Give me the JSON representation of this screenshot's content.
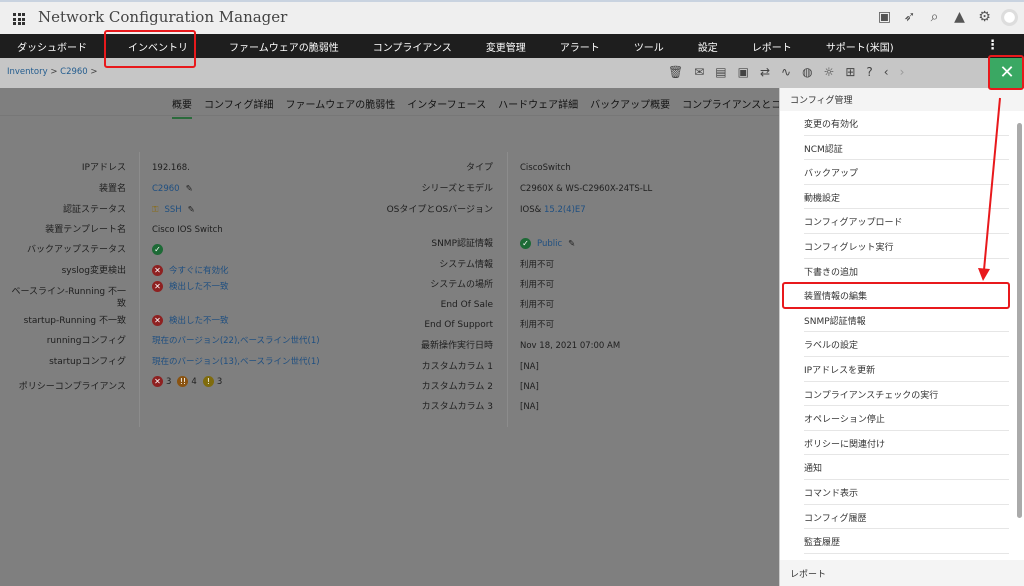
{
  "header": {
    "title": "Network Configuration Manager",
    "icons": [
      "presentation-icon",
      "rocket-icon",
      "search-icon",
      "bell-icon",
      "gear-icon",
      "user-avatar-icon"
    ]
  },
  "nav": [
    "ダッシュボード",
    "インベントリ",
    "ファームウェアの脆弱性",
    "コンプライアンス",
    "変更管理",
    "アラート",
    "ツール",
    "設定",
    "レポート",
    "サポート(米国)"
  ],
  "breadcrumb": {
    "root": "Inventory",
    "device": "C2960",
    "sep": ">"
  },
  "tabs": [
    "概要",
    "コンフィグ詳細",
    "ファームウェアの脆弱性",
    "インターフェース",
    "ハードウェア詳細",
    "バックアップ概要",
    "コンプライアンスとコン"
  ],
  "left_details": [
    {
      "label": "IPアドレス",
      "value": "192.168."
    },
    {
      "label": "装置名",
      "value": "C2960"
    },
    {
      "label": "認証ステータス",
      "value": "SSH"
    },
    {
      "label": "装置テンプレート名",
      "value": "Cisco IOS Switch"
    },
    {
      "label": "バックアップステータス",
      "value": ""
    },
    {
      "label": "syslog変更検出",
      "value": "今すぐに有効化"
    },
    {
      "label": "ベースライン-Running 不一致",
      "value": "検出した不一致"
    },
    {
      "label": "startup-Running 不一致",
      "value": "検出した不一致"
    },
    {
      "label": "runningコンフィグ",
      "value": "現在のバージョン(22),ベースライン世代(1)"
    },
    {
      "label": "startupコンフィグ",
      "value": "現在のバージョン(13),ベースライン世代(1)"
    },
    {
      "label": "ポリシーコンプライアンス",
      "value": "",
      "counts": [
        "3",
        "4",
        "3"
      ]
    }
  ],
  "right_details": [
    {
      "label": "タイプ",
      "value": "CiscoSwitch"
    },
    {
      "label": "シリーズとモデル",
      "value": "C2960X & WS-C2960X-24TS-LL"
    },
    {
      "label": "OSタイプとOSバージョン",
      "value": "IOS&",
      "link": "15.2(4)E7"
    },
    {
      "label": "SNMP認証情報",
      "value": "Public"
    },
    {
      "label": "システム情報",
      "value": "利用不可"
    },
    {
      "label": "システムの場所",
      "value": "利用不可"
    },
    {
      "label": "End Of Sale",
      "value": "利用不可"
    },
    {
      "label": "End Of Support",
      "value": "利用不可"
    },
    {
      "label": "最新操作実行日時",
      "value": "Nov 18, 2021 07:00 AM"
    },
    {
      "label": "カスタムカラム 1",
      "value": "[NA]"
    },
    {
      "label": "カスタムカラム 2",
      "value": "[NA]"
    },
    {
      "label": "カスタムカラム 3",
      "value": "[NA]"
    }
  ],
  "panel": {
    "header": "コンフィグ管理",
    "items": [
      "変更の有効化",
      "NCM認証",
      "バックアップ",
      "動機設定",
      "コンフィグアップロード",
      "コンフィグレット実行",
      "下書きの追加",
      "装置情報の編集",
      "SNMP認証情報",
      "ラベルの設定",
      "IPアドレスを更新",
      "コンプライアンスチェックの実行",
      "オペレーション停止",
      "ポリシーに関連付け",
      "通知",
      "コマンド表示",
      "コンフィグ履歴",
      "監査履歴"
    ],
    "footer": "レポート"
  },
  "close_label": "✕"
}
